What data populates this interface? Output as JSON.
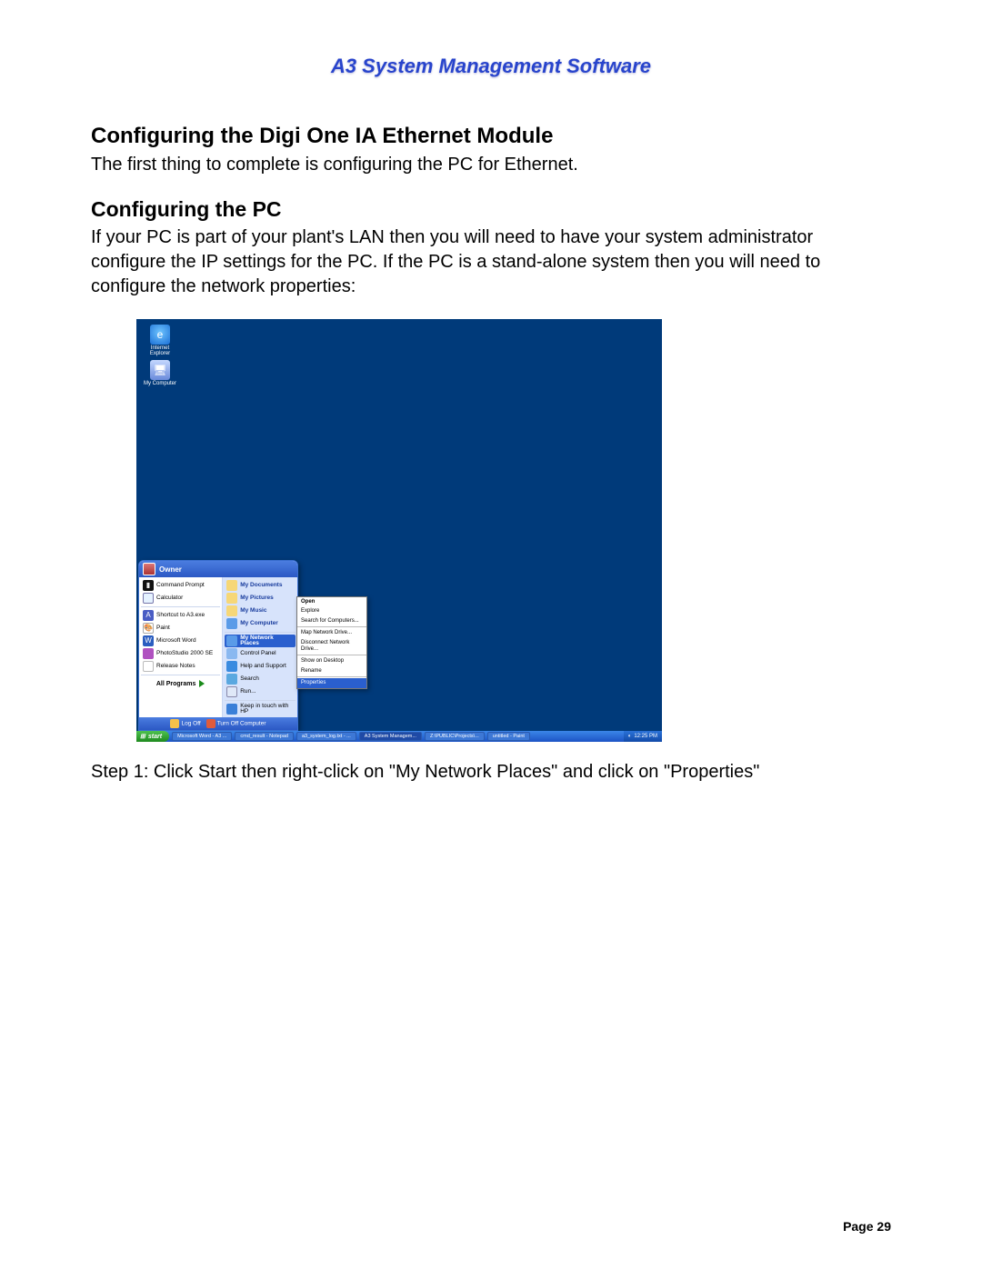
{
  "docTitle": "A3 System Management Software",
  "heading1": "Configuring the Digi One IA Ethernet Module",
  "para1": "The first thing to complete is configuring the PC for Ethernet.",
  "heading2": "Configuring the PC",
  "para2": "If your PC is part of your plant's LAN then you will need to have your system administrator configure the IP settings for the PC.  If the PC is a stand-alone system then you will need to configure the network properties:",
  "caption": "Step 1: Click Start then right-click on \"My Network Places\" and click on \"Properties\"",
  "pageNum": "Page 29",
  "desktop": {
    "icons": [
      {
        "label": "Internet Explorer"
      },
      {
        "label": "My Computer"
      }
    ]
  },
  "startMenu": {
    "owner": "Owner",
    "left": [
      {
        "label": "Command Prompt"
      },
      {
        "label": "Calculator"
      },
      {
        "label": "Shortcut to A3.exe"
      },
      {
        "label": "Paint"
      },
      {
        "label": "Microsoft Word"
      },
      {
        "label": "PhotoStudio 2000 SE"
      },
      {
        "label": "Release Notes"
      }
    ],
    "allPrograms": "All Programs",
    "right": [
      {
        "label": "My Documents",
        "bold": true
      },
      {
        "label": "My Pictures",
        "bold": true
      },
      {
        "label": "My Music",
        "bold": true
      },
      {
        "label": "My Computer",
        "bold": true
      },
      {
        "label": "My Network Places",
        "bold": true,
        "selected": true
      },
      {
        "label": "Control Panel"
      },
      {
        "label": "Help and Support"
      },
      {
        "label": "Search"
      },
      {
        "label": "Run..."
      },
      {
        "label": "Keep in touch with HP"
      }
    ],
    "footer": {
      "logoff": "Log Off",
      "turnoff": "Turn Off Computer"
    }
  },
  "contextMenu": {
    "items": [
      {
        "label": "Open",
        "bold": true
      },
      {
        "label": "Explore"
      },
      {
        "label": "Search for Computers..."
      },
      {
        "sep": true
      },
      {
        "label": "Map Network Drive..."
      },
      {
        "label": "Disconnect Network Drive..."
      },
      {
        "sep": true
      },
      {
        "label": "Show on Desktop"
      },
      {
        "label": "Rename"
      },
      {
        "sep": true
      },
      {
        "label": "Properties",
        "selected": true
      }
    ]
  },
  "taskbar": {
    "start": "start",
    "items": [
      {
        "label": "Microsoft Word - A3 ..."
      },
      {
        "label": "cmd_result - Notepad"
      },
      {
        "label": "a3_system_log.txt - ..."
      },
      {
        "label": "A3 System Managem...",
        "active": true
      },
      {
        "label": "Z:\\PUBLIC\\Projects\\..."
      },
      {
        "label": "untitled - Paint"
      }
    ],
    "clock": "12:25 PM"
  }
}
